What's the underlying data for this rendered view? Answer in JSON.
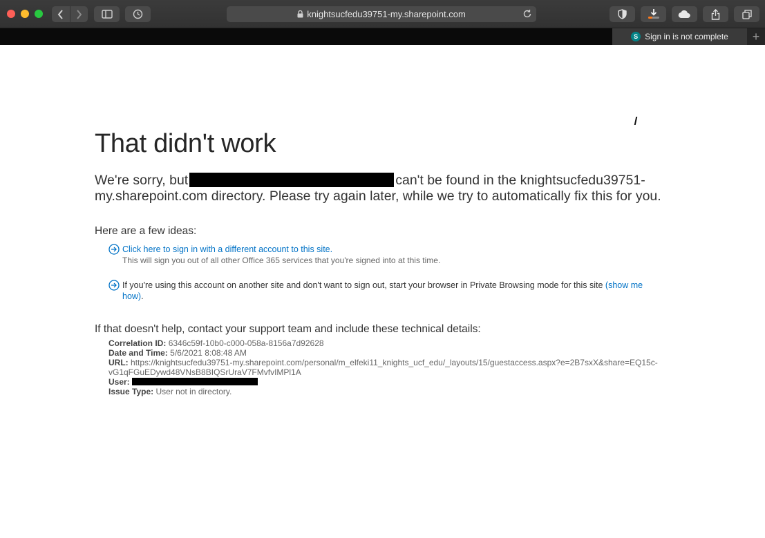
{
  "browser": {
    "url": "knightsucfedu39751-my.sharepoint.com",
    "active_tab": {
      "label": "Sign in is not complete",
      "icon_letter": "S"
    },
    "new_tab_glyph": "+"
  },
  "page": {
    "title": "That didn't work",
    "sorry_prefix": "We're sorry, but",
    "sorry_suffix": "can't be found in the knightsucfedu39751-my.sharepoint.com directory. Please try again later, while we try to automatically fix this for you.",
    "ideas_title": "Here are a few ideas:",
    "idea1_link": "Click here to sign in with a different account to this site.",
    "idea1_note": "This will sign you out of all other Office 365 services that you're signed into at this time.",
    "idea2_text": "If you're using this account on another site and don't want to sign out, start your browser in Private Browsing mode for this site",
    "idea2_link": "(show me how)",
    "idea2_end": ".",
    "help_title": "If that doesn't help, contact your support team and include these technical details:",
    "details": {
      "correlation_label": "Correlation ID:",
      "correlation_value": "6346c59f-10b0-c000-058a-8156a7d92628",
      "datetime_label": "Date and Time:",
      "datetime_value": "5/6/2021 8:08:48 AM",
      "url_label": "URL:",
      "url_value": "https://knightsucfedu39751-my.sharepoint.com/personal/m_elfeki11_knights_ucf_edu/_layouts/15/guestaccess.aspx?e=2B7sxX&share=EQ15c-vG1qFGuEDywd48VNsB8BIQSrUraV7FMvfvIMPl1A",
      "user_label": "User:",
      "issue_label": "Issue Type:",
      "issue_value": "User not in directory."
    }
  },
  "colors": {
    "link": "#0072c6",
    "title": "#262626",
    "chrome": "#323232"
  }
}
